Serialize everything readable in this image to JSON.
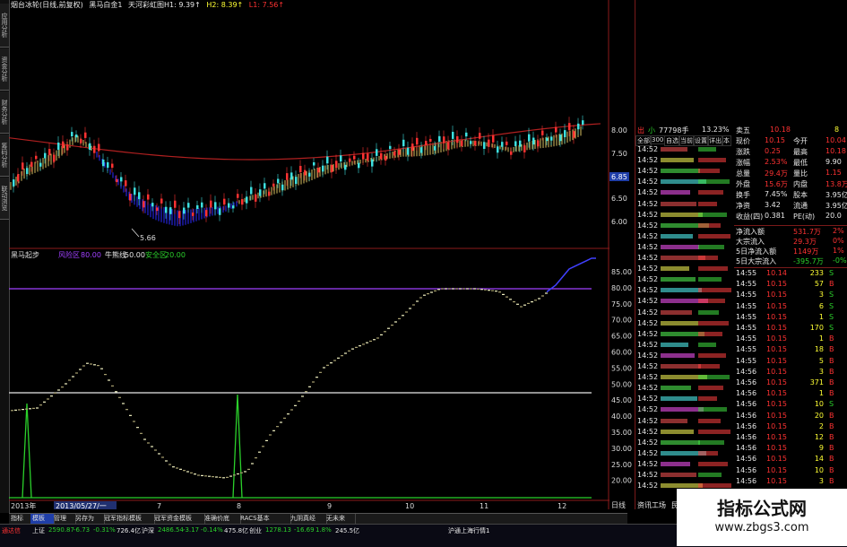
{
  "left_tabs": [
    "应用分析",
    "资金分析",
    "财务分析",
    "筹码分析",
    "联动浏览"
  ],
  "title_bar": {
    "a": "烟台冰轮(日线,前复权)",
    "b": "黑马白金1",
    "c": "天河彩虹图H1: 9.39↑",
    "d": "H2: 8.39↑",
    "e": "L1: 7.56↑"
  },
  "upper_chart": {
    "low_label": "5.66",
    "ticks": [
      "8.00",
      "7.50",
      "7.00",
      "6.50",
      "6.00"
    ],
    "price_tag": "6.85"
  },
  "indicator": {
    "name": "黑马起步",
    "l1": "风险区",
    "v1": "80.00",
    "l2": "牛熊线",
    "v2": "50.00",
    "l3": "安全区",
    "v3": "20.00",
    "ticks": [
      "85.00",
      "80.00",
      "75.00",
      "70.00",
      "65.00",
      "60.00",
      "55.00",
      "50.00",
      "45.00",
      "40.00",
      "35.00",
      "30.00",
      "25.00",
      "20.00"
    ]
  },
  "x_axis": {
    "first": "2013年",
    "date_box": "2013/05/27/一",
    "labels": [
      "7",
      "8",
      "9",
      "10",
      "11",
      "12"
    ],
    "corner": "日线"
  },
  "rp_top": {
    "t1": "出",
    "t2": "小",
    "t3": "77798手",
    "t4": "13.23%"
  },
  "rp_tabs": [
    "全部",
    "300",
    "自选",
    "当前",
    "设置",
    "详出",
    "本"
  ],
  "quote": {
    "sell5": {
      "label": "卖五",
      "price": "10.18",
      "vol": "8"
    },
    "rows": [
      {
        "l": "现价",
        "v": "10.15",
        "l2": "今开",
        "v2": "10.04"
      },
      {
        "l": "涨跌",
        "v": "0.25",
        "l2": "最高",
        "v2": "10.18"
      },
      {
        "l": "涨幅",
        "v": "2.53%",
        "l2": "最低",
        "v2": "9.90"
      },
      {
        "l": "总量",
        "v": "29.4万",
        "l2": "量比",
        "v2": "1.15"
      },
      {
        "l": "外盘",
        "v": "15.6万",
        "l2": "内盘",
        "v2": "13.8万"
      },
      {
        "l": "换手",
        "v": "7.45%",
        "l2": "股本",
        "v2": "3.95亿"
      },
      {
        "l": "净资",
        "v": "3.42",
        "l2": "流通",
        "v2": "3.95亿"
      },
      {
        "l": "收益(四)",
        "v": "0.381",
        "l2": "PE(动)",
        "v2": "20.0"
      }
    ],
    "flow": [
      {
        "l": "净流入额",
        "v": "531.7万",
        "p": "2%"
      },
      {
        "l": "大宗流入",
        "v": "29.3万",
        "p": "0%"
      },
      {
        "l": "5日净流入额",
        "v": "1149万",
        "p": "1%"
      },
      {
        "l": "5日大宗流入",
        "v": "-395.7万",
        "p": "-0%"
      }
    ],
    "ticks": [
      {
        "t": "14:55",
        "p": "10.14",
        "v": "233",
        "f": "S"
      },
      {
        "t": "14:55",
        "p": "10.15",
        "v": "57",
        "f": "B"
      },
      {
        "t": "14:55",
        "p": "10.15",
        "v": "3",
        "f": "S"
      },
      {
        "t": "14:55",
        "p": "10.15",
        "v": "6",
        "f": "S"
      },
      {
        "t": "14:55",
        "p": "10.15",
        "v": "1",
        "f": "S"
      },
      {
        "t": "14:55",
        "p": "10.15",
        "v": "170",
        "f": "S"
      },
      {
        "t": "14:55",
        "p": "10.15",
        "v": "1",
        "f": "B"
      },
      {
        "t": "14:55",
        "p": "10.15",
        "v": "18",
        "f": "B"
      },
      {
        "t": "14:55",
        "p": "10.15",
        "v": "5",
        "f": "B"
      },
      {
        "t": "14:56",
        "p": "10.15",
        "v": "3",
        "f": "B"
      },
      {
        "t": "14:56",
        "p": "10.15",
        "v": "371",
        "f": "B"
      },
      {
        "t": "14:56",
        "p": "10.15",
        "v": "1",
        "f": "B"
      },
      {
        "t": "14:56",
        "p": "10.15",
        "v": "10",
        "f": "S"
      },
      {
        "t": "14:56",
        "p": "10.15",
        "v": "20",
        "f": "B"
      },
      {
        "t": "14:56",
        "p": "10.15",
        "v": "2",
        "f": "B"
      },
      {
        "t": "14:56",
        "p": "10.15",
        "v": "12",
        "f": "B"
      },
      {
        "t": "14:56",
        "p": "10.15",
        "v": "9",
        "f": "B"
      },
      {
        "t": "14:56",
        "p": "10.15",
        "v": "14",
        "f": "B"
      },
      {
        "t": "14:56",
        "p": "10.15",
        "v": "10",
        "f": "B"
      },
      {
        "t": "14:56",
        "p": "10.15",
        "v": "3",
        "f": "B"
      }
    ]
  },
  "news_time": "14:52",
  "bottom_tabs": [
    "指标",
    "模板",
    "管理",
    "另存为",
    "冠军指标模板",
    "冠军资金模板",
    "准确价底",
    "RACS基本",
    "九阴真经",
    "无未来"
  ],
  "right_bottom": {
    "a": "资讯工场",
    "b": "民生"
  },
  "status": {
    "s1": "通达信",
    "s2": "上证",
    "s3": "2590.87",
    "s4": "-6.73",
    "s5": "-0.31%",
    "s6": "726.4亿",
    "s7": "沪深",
    "s8": "2486.54",
    "s9": "-3.17",
    "s10": "-0.14%",
    "s11": "475.8亿",
    "s12": "创业",
    "s13": "1278.13",
    "s14": "-16.69",
    "s15": "1.8%",
    "s16": "245.5亿",
    "s17": "沪通上海行情1"
  },
  "watermark": {
    "title": "指标公式网",
    "url": "www.zbgs3.com"
  },
  "colors": {
    "up": "#ff3232",
    "down": "#2bd02b",
    "rule": "#8a2be2",
    "text": "#c0c0c0"
  }
}
